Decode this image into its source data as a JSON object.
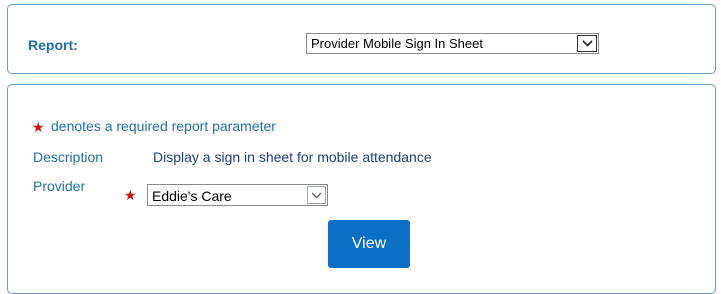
{
  "report": {
    "label": "Report:",
    "selected": "Provider Mobile Sign In Sheet"
  },
  "parameters": {
    "required_marker": "★",
    "required_note": "denotes a required report parameter",
    "description_label": "Description",
    "description_value": "Display a sign in sheet for mobile attendance",
    "provider_label": "Provider",
    "provider_selected": "Eddie's Care",
    "view_button_label": "View"
  },
  "colors": {
    "accent": "#1f6fb5",
    "panel_border": "#6a9cc9",
    "required_star": "#d01010",
    "button_bg": "#0b6fc6"
  },
  "icons": {
    "dropdown": "chevron-down-icon",
    "required": "star-icon"
  }
}
